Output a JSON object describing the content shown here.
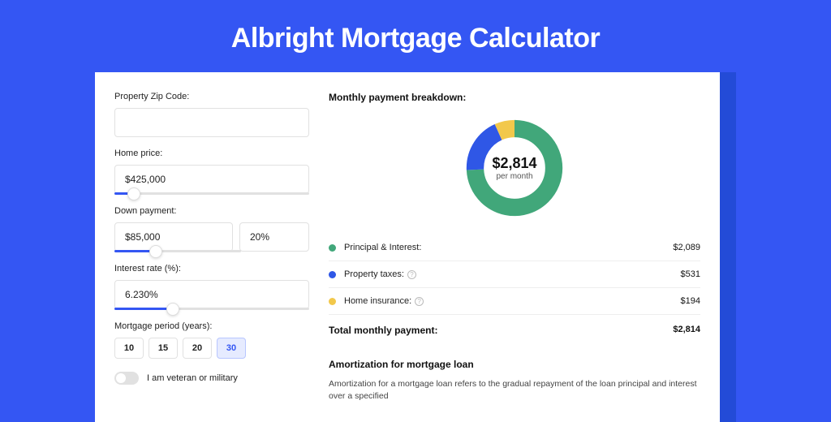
{
  "page": {
    "title": "Albright Mortgage Calculator"
  },
  "form": {
    "zip": {
      "label": "Property Zip Code:",
      "value": ""
    },
    "home_price": {
      "label": "Home price:",
      "value": "$425,000",
      "slider_pct": 10
    },
    "down_payment": {
      "label": "Down payment:",
      "amount": "$85,000",
      "percent": "20%",
      "slider_pct": 22
    },
    "interest_rate": {
      "label": "Interest rate (%):",
      "value": "6.230%",
      "slider_pct": 30
    },
    "period": {
      "label": "Mortgage period (years):",
      "options": [
        "10",
        "15",
        "20",
        "30"
      ],
      "selected": "30"
    },
    "veteran": {
      "label": "I am veteran or military",
      "on": false
    }
  },
  "breakdown": {
    "title": "Monthly payment breakdown:",
    "center_amount": "$2,814",
    "center_sub": "per month",
    "items": [
      {
        "label": "Principal & Interest:",
        "value": "$2,089",
        "color": "#41a77a",
        "pct": 74.2,
        "info": false
      },
      {
        "label": "Property taxes:",
        "value": "$531",
        "color": "#2f57e6",
        "pct": 18.9,
        "info": true
      },
      {
        "label": "Home insurance:",
        "value": "$194",
        "color": "#f2c84b",
        "pct": 6.9,
        "info": true
      }
    ],
    "total_label": "Total monthly payment:",
    "total_value": "$2,814"
  },
  "amortization": {
    "title": "Amortization for mortgage loan",
    "text": "Amortization for a mortgage loan refers to the gradual repayment of the loan principal and interest over a specified"
  },
  "chart_data": {
    "type": "pie",
    "title": "Monthly payment breakdown",
    "categories": [
      "Principal & Interest",
      "Property taxes",
      "Home insurance"
    ],
    "values": [
      2089,
      531,
      194
    ],
    "colors": [
      "#41a77a",
      "#2f57e6",
      "#f2c84b"
    ],
    "total": 2814,
    "unit": "USD/month"
  }
}
